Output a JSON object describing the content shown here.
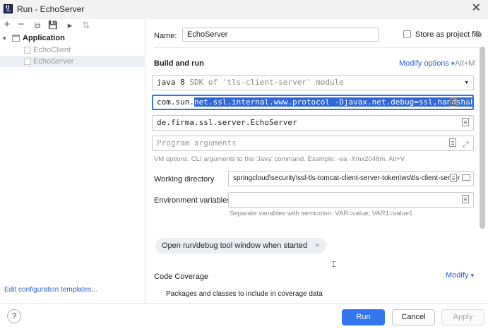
{
  "window": {
    "title": "Run - EchoServer",
    "close_glyph": "✕"
  },
  "toolbar": {
    "add": "+",
    "remove": "−",
    "copy": "⧉",
    "save": "💾",
    "move": "▸",
    "sort": "⇅"
  },
  "tree": {
    "root": {
      "label": "Application",
      "expander": "▾"
    },
    "items": [
      {
        "label": "EchoClient"
      },
      {
        "label": "EchoServer"
      }
    ]
  },
  "edit_templates": "Edit configuration templates...",
  "form": {
    "name_label": "Name:",
    "name_value": "EchoServer",
    "store_label": "Store as project file",
    "build_run_title": "Build and run",
    "modify_options": "Modify options",
    "modify_options_shortcut": "Alt+M",
    "sdk_java": "java 8",
    "sdk_desc": "SDK of 'tls-client-server' module",
    "vm_prefix": "com.sun.",
    "vm_selected": "net.ssl.internal.www.protocol -Djavax.net.debug=ssl,handshake",
    "main_class": "de.firma.ssl.server.EchoServer",
    "program_args_placeholder": "Program arguments",
    "vm_hint": "VM options. CLI arguments to the 'Java' command. Example: -ea -Xmx2048m. Alt+V",
    "working_dir_label": "Working directory",
    "working_dir_value": "springcloud\\security\\ssl-tls-tomcat-client-server-token\\ws\\tls-client-server",
    "env_label": "Environment variables:",
    "env_hint": "Separate variables with semicolon: VAR=value; VAR1=value1",
    "chip_label": "Open run/debug tool window when started",
    "chip_close": "×",
    "coverage_title": "Code Coverage",
    "coverage_modify": "Modify",
    "coverage_packages": "Packages and classes to include in coverage data"
  },
  "buttons": {
    "help": "?",
    "run": "Run",
    "cancel": "Cancel",
    "apply": "Apply"
  },
  "icons": {
    "dropdown": "▾",
    "expand": "⤢",
    "cursor": "⌶"
  },
  "colors": {
    "accent": "#3574f0",
    "link": "#2d64c8",
    "selection": "#2f66d9"
  }
}
